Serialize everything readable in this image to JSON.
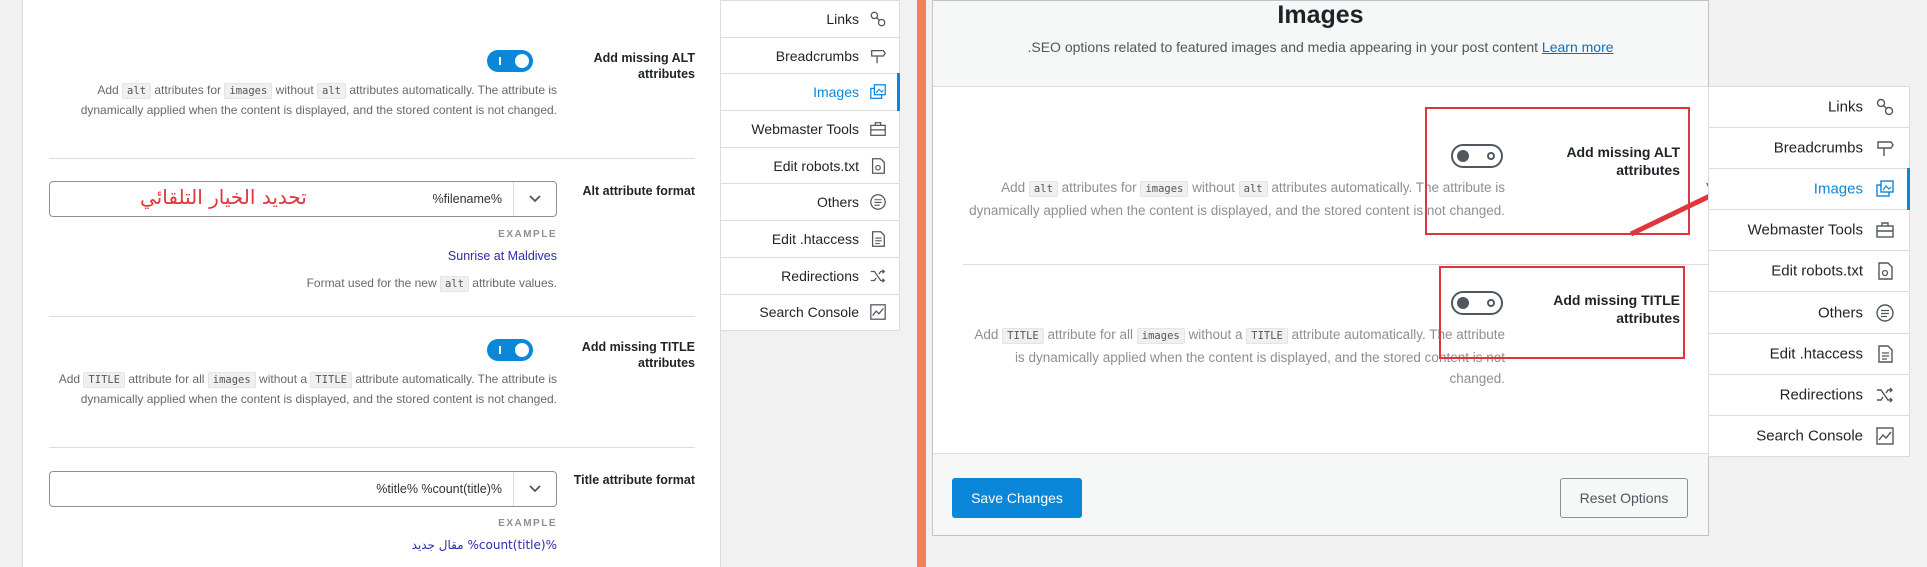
{
  "left": {
    "alt": {
      "title": "Add missing ALT attributes",
      "desc_parts": [
        "Add ",
        "alt",
        " attributes for ",
        "images",
        " without ",
        "alt",
        " attributes automatically. The attribute is dynamically applied when the content is displayed, and the stored content is not changed."
      ]
    },
    "alt_format": {
      "title": "Alt attribute format",
      "value": "%filename%",
      "annotation": "تحديد الخيار التلقائي",
      "example_label": "EXAMPLE",
      "example_value": "Sunrise at Maldives",
      "note_parts": [
        "Format used for the new ",
        "alt",
        " attribute values."
      ]
    },
    "title_attr": {
      "title": "Add missing TITLE attributes",
      "desc_parts": [
        "Add ",
        "TITLE",
        " attribute for all ",
        "images",
        " without a ",
        "TITLE",
        " attribute automatically. The attribute is dynamically applied when the content is displayed, and the stored content is not changed."
      ]
    },
    "title_format": {
      "title": "Title attribute format",
      "value": "%title% %count(title)%",
      "example_label": "EXAMPLE",
      "example_value": "مقال جديد %count(title)%"
    },
    "tabs": [
      {
        "label": "Links",
        "icon": "link-icon"
      },
      {
        "label": "Breadcrumbs",
        "icon": "signpost-icon"
      },
      {
        "label": "Images",
        "icon": "images-icon",
        "active": true
      },
      {
        "label": "Webmaster Tools",
        "icon": "toolbox-icon"
      },
      {
        "label": "Edit robots.txt",
        "icon": "robot-file-icon"
      },
      {
        "label": "Others",
        "icon": "list-circle-icon"
      },
      {
        "label": "Edit .htaccess",
        "icon": "document-icon"
      },
      {
        "label": "Redirections",
        "icon": "shuffle-icon"
      },
      {
        "label": "Search Console",
        "icon": "chart-line-icon"
      }
    ]
  },
  "right": {
    "title": "Images",
    "subtitle": "SEO options related to featured images and media appearing in your post content.",
    "learn_more": "Learn more",
    "alt": {
      "title": "Add missing ALT attributes",
      "desc_parts": [
        "Add ",
        "alt",
        " attributes for ",
        "images",
        " without ",
        "alt",
        " attributes automatically. The attribute is dynamically applied when the content is displayed, and the stored content is not changed."
      ]
    },
    "title_attr": {
      "title": "Add missing TITLE attributes",
      "desc_parts": [
        "Add ",
        "TITLE",
        " attribute for all ",
        "images",
        " without a ",
        "TITLE",
        " attribute automatically. The attribute is dynamically applied when the content is displayed, and the stored content is not changed."
      ]
    },
    "save_label": "Save Changes",
    "reset_label": "Reset Options",
    "tabs": [
      {
        "label": "Links",
        "icon": "link-icon"
      },
      {
        "label": "Breadcrumbs",
        "icon": "signpost-icon"
      },
      {
        "label": "Images",
        "icon": "images-icon",
        "active": true
      },
      {
        "label": "Webmaster Tools",
        "icon": "toolbox-icon"
      },
      {
        "label": "Edit robots.txt",
        "icon": "robot-file-icon"
      },
      {
        "label": "Others",
        "icon": "list-circle-icon"
      },
      {
        "label": "Edit .htaccess",
        "icon": "document-icon"
      },
      {
        "label": "Redirections",
        "icon": "shuffle-icon"
      },
      {
        "label": "Search Console",
        "icon": "chart-line-icon"
      }
    ]
  },
  "colors": {
    "accent": "#0b87d9",
    "annotation_red": "#e0353a",
    "divider_orange": "#f0825a"
  }
}
